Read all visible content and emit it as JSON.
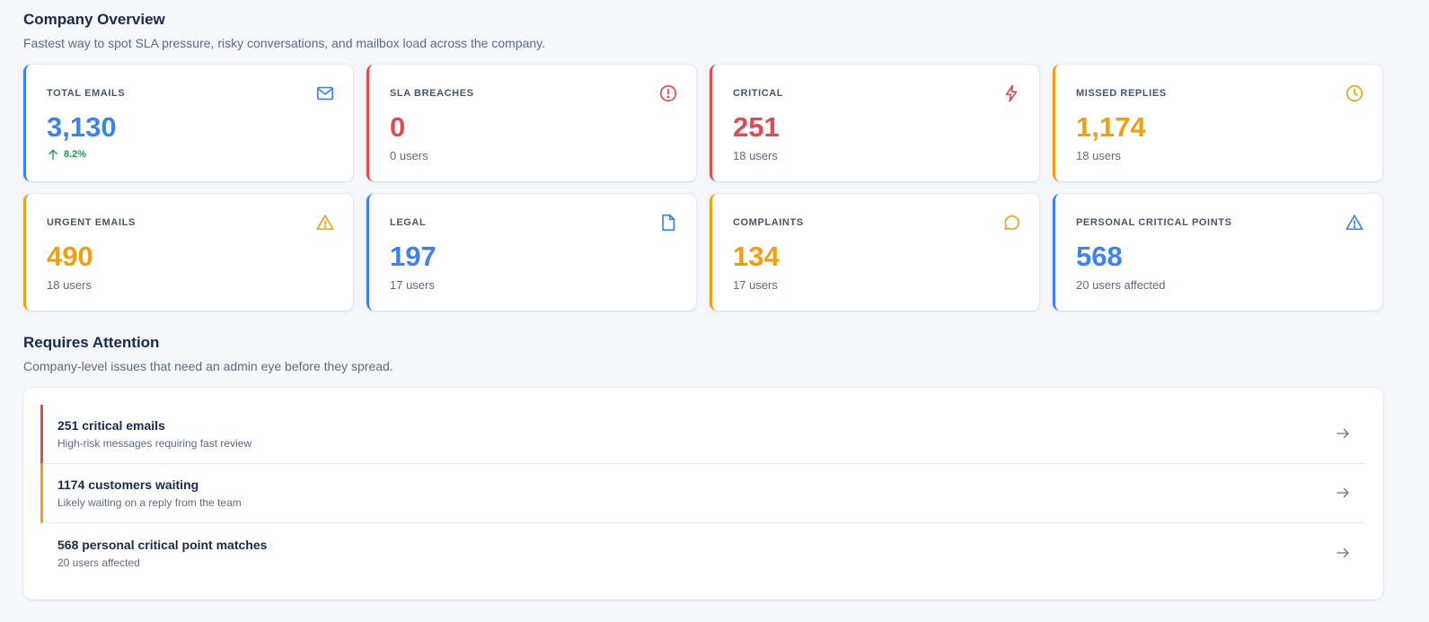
{
  "overview": {
    "title": "Company Overview",
    "subtitle": "Fastest way to spot SLA pressure, risky conversations, and mailbox load across the company."
  },
  "cards": [
    {
      "label": "TOTAL EMAILS",
      "value": "3,130",
      "trend": "8.2%",
      "icon": "mail-icon",
      "accent": "#3b82f6"
    },
    {
      "label": "SLA BREACHES",
      "value": "0",
      "foot": "0 users",
      "icon": "alert-circle-icon",
      "accent": "#e5484d"
    },
    {
      "label": "CRITICAL",
      "value": "251",
      "foot": "18 users",
      "icon": "lightning-icon",
      "accent": "#e5484d"
    },
    {
      "label": "MISSED REPLIES",
      "value": "1,174",
      "foot": "18 users",
      "icon": "clock-icon",
      "accent": "#f59e0b"
    },
    {
      "label": "URGENT EMAILS",
      "value": "490",
      "foot": "18 users",
      "icon": "warning-triangle-icon",
      "accent": "#f59e0b"
    },
    {
      "label": "LEGAL",
      "value": "197",
      "foot": "17 users",
      "icon": "document-icon",
      "accent": "#3b82f6"
    },
    {
      "label": "COMPLAINTS",
      "value": "134",
      "foot": "17 users",
      "icon": "chat-bubble-icon",
      "accent": "#f59e0b"
    },
    {
      "label": "PERSONAL CRITICAL POINTS",
      "value": "568",
      "foot": "20 users affected",
      "icon": "warning-triangle-icon",
      "accent": "#3b82f6"
    }
  ],
  "attention": {
    "title": "Requires Attention",
    "subtitle": "Company-level issues that need an admin eye before they spread.",
    "items": [
      {
        "title": "251 critical emails",
        "subtitle": "High-risk messages requiring fast review",
        "bar": "#e5484d"
      },
      {
        "title": "1174 customers waiting",
        "subtitle": "Likely waiting on a reply from the team",
        "bar": "#f59e0b"
      },
      {
        "title": "568 personal critical point matches",
        "subtitle": "20 users affected",
        "bar": "transparent"
      }
    ]
  },
  "colors": {
    "trend_up": "#16a34a"
  }
}
